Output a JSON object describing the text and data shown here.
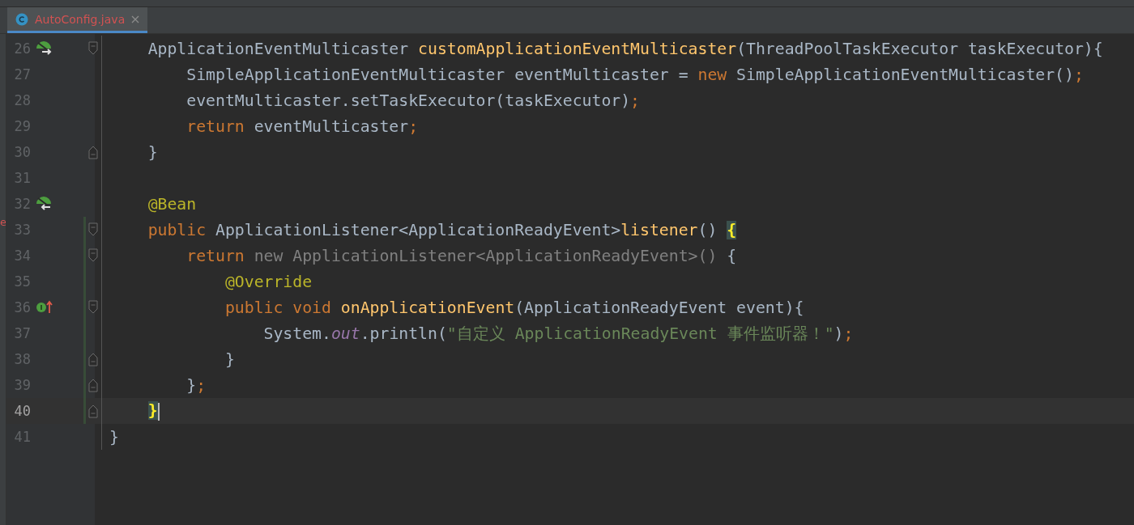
{
  "tabs": [
    {
      "label": "AutoConfig.java",
      "selected": true
    }
  ],
  "left_edge_mark": "e",
  "lines": [
    {
      "number": "26",
      "gutter_icon": {
        "kind": "bean-out"
      },
      "fold": {
        "kind": "start"
      },
      "vcs_changed": false,
      "current": false,
      "tokens": [
        {
          "kind": "plain",
          "text": "    ApplicationEventMulticaster "
        },
        {
          "kind": "method",
          "text": "customApplicationEventMulticaster"
        },
        {
          "kind": "plain",
          "text": "(ThreadPoolTaskExecutor taskExecutor){"
        }
      ]
    },
    {
      "number": "27",
      "vcs_changed": false,
      "current": false,
      "tokens": [
        {
          "kind": "plain",
          "text": "        SimpleApplicationEventMulticaster eventMulticaster = "
        },
        {
          "kind": "keyword",
          "text": "new"
        },
        {
          "kind": "plain",
          "text": " SimpleApplicationEventMulticaster()"
        },
        {
          "kind": "keyword",
          "text": ";"
        }
      ]
    },
    {
      "number": "28",
      "vcs_changed": false,
      "current": false,
      "tokens": [
        {
          "kind": "plain",
          "text": "        eventMulticaster.setTaskExecutor(taskExecutor)"
        },
        {
          "kind": "keyword",
          "text": ";"
        }
      ]
    },
    {
      "number": "29",
      "vcs_changed": false,
      "current": false,
      "tokens": [
        {
          "kind": "keyword",
          "text": "        return"
        },
        {
          "kind": "plain",
          "text": " eventMulticaster"
        },
        {
          "kind": "keyword",
          "text": ";"
        }
      ]
    },
    {
      "number": "30",
      "fold": {
        "kind": "end"
      },
      "vcs_changed": false,
      "current": false,
      "tokens": [
        {
          "kind": "plain",
          "text": "    }"
        }
      ]
    },
    {
      "number": "31",
      "vcs_changed": false,
      "current": false
    },
    {
      "number": "32",
      "gutter_icon": {
        "kind": "bean-in"
      },
      "vcs_changed": false,
      "current": false,
      "tokens": [
        {
          "kind": "annotation",
          "text": "    @Bean"
        }
      ]
    },
    {
      "number": "33",
      "fold": {
        "kind": "start"
      },
      "vcs_changed": true,
      "current": false,
      "tokens": [
        {
          "kind": "keyword",
          "text": "    public"
        },
        {
          "kind": "plain",
          "text": " ApplicationListener<ApplicationReadyEvent>"
        },
        {
          "kind": "method",
          "text": "listener"
        },
        {
          "kind": "plain",
          "text": "() "
        },
        {
          "kind": "brace-match",
          "text": "{"
        }
      ]
    },
    {
      "number": "34",
      "fold": {
        "kind": "start"
      },
      "vcs_changed": true,
      "current": false,
      "tokens": [
        {
          "kind": "keyword",
          "text": "        return"
        },
        {
          "kind": "muted",
          "text": " new ApplicationListener<ApplicationReadyEvent>()"
        },
        {
          "kind": "plain",
          "text": " {"
        }
      ]
    },
    {
      "number": "35",
      "vcs_changed": true,
      "current": false,
      "tokens": [
        {
          "kind": "annotation",
          "text": "            @Override"
        }
      ]
    },
    {
      "number": "36",
      "gutter_icon": {
        "kind": "implements"
      },
      "fold": {
        "kind": "start"
      },
      "vcs_changed": true,
      "current": false,
      "tokens": [
        {
          "kind": "keyword",
          "text": "            public void "
        },
        {
          "kind": "method",
          "text": "onApplicationEvent"
        },
        {
          "kind": "plain",
          "text": "(ApplicationReadyEvent event){"
        }
      ]
    },
    {
      "number": "37",
      "vcs_changed": true,
      "current": false,
      "tokens": [
        {
          "kind": "plain",
          "text": "                System."
        },
        {
          "kind": "static",
          "text": "out"
        },
        {
          "kind": "plain",
          "text": ".println("
        },
        {
          "kind": "string",
          "text": "\"自定义 ApplicationReadyEvent 事件监听器！\""
        },
        {
          "kind": "plain",
          "text": ")"
        },
        {
          "kind": "keyword",
          "text": ";"
        }
      ]
    },
    {
      "number": "38",
      "fold": {
        "kind": "end"
      },
      "vcs_changed": true,
      "current": false,
      "tokens": [
        {
          "kind": "plain",
          "text": "            }"
        }
      ]
    },
    {
      "number": "39",
      "fold": {
        "kind": "end"
      },
      "vcs_changed": true,
      "current": false,
      "tokens": [
        {
          "kind": "plain",
          "text": "        }"
        },
        {
          "kind": "keyword",
          "text": ";"
        }
      ]
    },
    {
      "number": "40",
      "fold": {
        "kind": "end"
      },
      "vcs_changed": true,
      "current": true,
      "tokens": [
        {
          "kind": "brace-match",
          "text": "    }"
        }
      ]
    },
    {
      "number": "41",
      "vcs_changed": false,
      "current": false,
      "tokens": [
        {
          "kind": "plain",
          "text": "}"
        }
      ]
    }
  ]
}
